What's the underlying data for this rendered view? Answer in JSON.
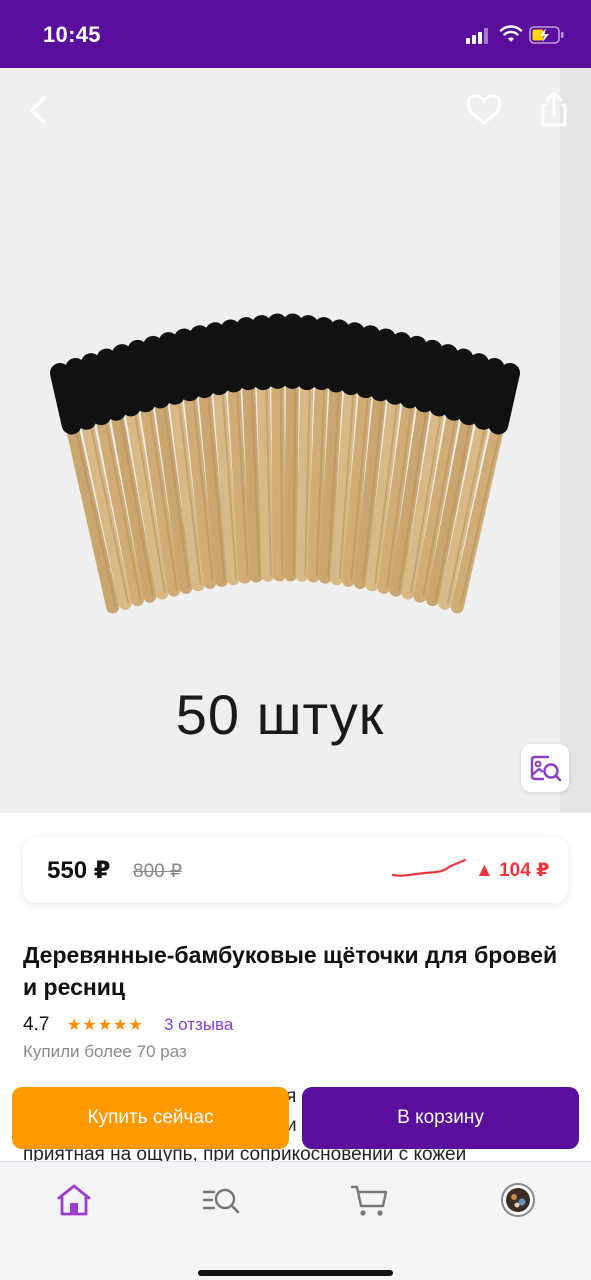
{
  "status_bar": {
    "time": "10:45"
  },
  "hero": {
    "caption": "50 штук"
  },
  "price": {
    "current": "550 ₽",
    "old": "800 ₽",
    "delta": "▲ 104 ₽"
  },
  "product": {
    "title": "Деревянные-бамбуковые щёточки для бровей и ресниц",
    "rating": "4.7",
    "stars": "★★★★★",
    "reviews": "3 отзыва",
    "bought": "Купили более 70 раз"
  },
  "description": {
    "line1": "я",
    "line2": "и",
    "line3": "приятная на ощупь, при соприкосновении с кожей"
  },
  "actions": {
    "buy_now": "Купить сейчас",
    "add_to_cart": "В корзину"
  },
  "colors": {
    "brand": "#5a0f9c",
    "buy_now": "#ff9a00",
    "price_up": "#f0353d",
    "link": "#8a3ec8",
    "stars": "#ff8c00"
  },
  "icons": {
    "back": "chevron-left-icon",
    "favorite": "heart-icon",
    "share": "share-icon",
    "photo_search": "image-search-icon",
    "home": "home-icon",
    "catalog": "catalog-search-icon",
    "cart": "cart-icon",
    "profile": "avatar"
  }
}
